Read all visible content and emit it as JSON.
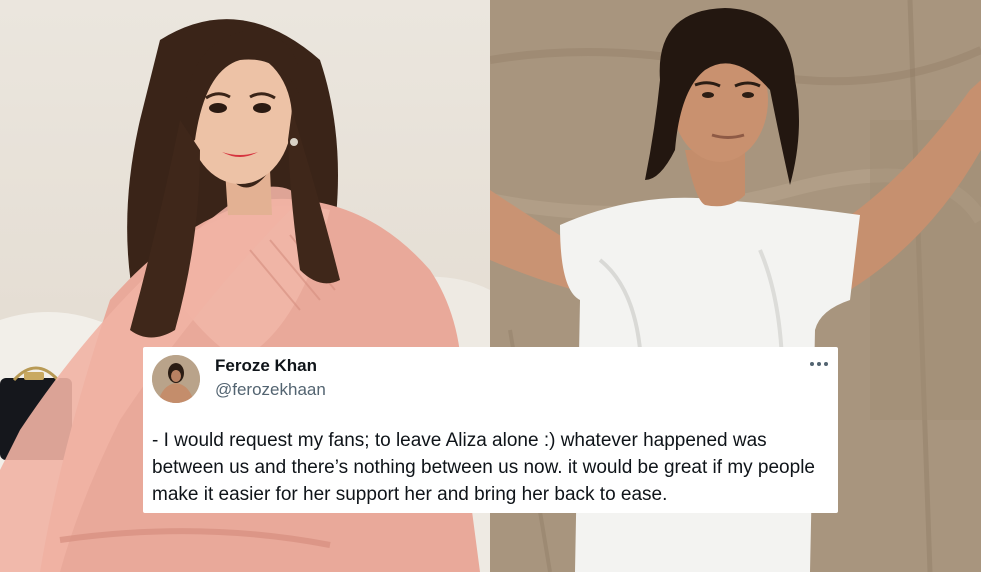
{
  "tweet": {
    "author": {
      "display_name": "Feroze Khan",
      "handle": "@ferozekhaan",
      "avatar_icon": "profile-avatar"
    },
    "more_icon": "more-horizontal-icon",
    "text": "- I would request my fans; to leave Aliza alone :) whatever happened was between us and there’s nothing between us now. it would be great if my people make it easier for her support her and bring her back to ease."
  },
  "colors": {
    "card_background": "#ffffff",
    "name_color": "#0f1419",
    "handle_color": "#536471",
    "text_color": "#0f1419"
  }
}
